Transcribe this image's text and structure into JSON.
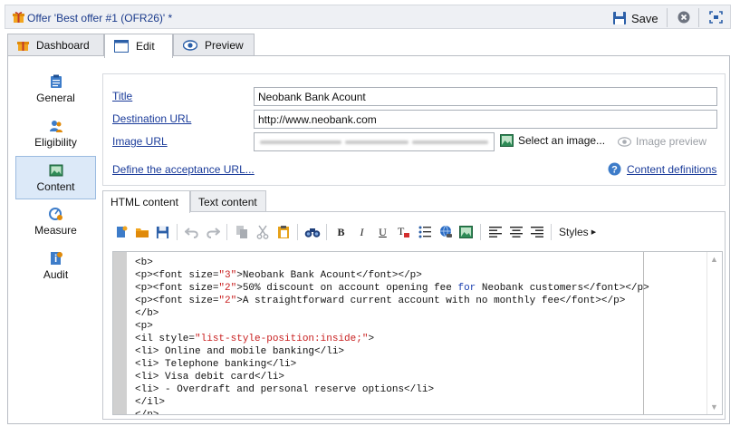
{
  "window": {
    "title": "Offer 'Best offer #1 (OFR26)' *",
    "save_label": "Save"
  },
  "tabs": [
    {
      "label": "Dashboard",
      "icon": "gift-icon"
    },
    {
      "label": "Edit",
      "icon": "edit-window-icon",
      "active": true
    },
    {
      "label": "Preview",
      "icon": "eye-icon"
    }
  ],
  "sidebar": {
    "items": [
      {
        "label": "General",
        "icon": "clipboard-icon"
      },
      {
        "label": "Eligibility",
        "icon": "users-icon"
      },
      {
        "label": "Content",
        "icon": "picture-icon",
        "selected": true
      },
      {
        "label": "Measure",
        "icon": "gauge-icon"
      },
      {
        "label": "Audit",
        "icon": "info-doc-icon"
      }
    ]
  },
  "form": {
    "title_label": "Title",
    "title_value": "Neobank Bank Acount",
    "dest_label": "Destination URL",
    "dest_value": "http://www.neobank.com",
    "image_label": "Image URL",
    "select_image": "Select an image...",
    "image_preview": "Image preview",
    "acceptance_link": "Define the acceptance URL...",
    "content_defs": "Content definitions"
  },
  "content_tabs": [
    {
      "label": "HTML content",
      "active": true
    },
    {
      "label": "Text content"
    }
  ],
  "toolbar": {
    "bold": "B",
    "italic": "I",
    "underline": "U",
    "styles": "Styles"
  },
  "code_lines": [
    "<b>",
    "<p><font size=\"3\">Neobank Bank Acount</font></p>",
    "<p><font size=\"2\">50% discount on account opening fee for Neobank customers</font></p>",
    "<p><font size=\"2\">A straightforward current account with no monthly fee</font></p>",
    "</b>",
    "<p>",
    "<il style=\"list-style-position:inside;\">",
    "<li> Online and mobile banking</li>",
    "<li> Telephone banking</li>",
    "<li> Visa debit card</li>",
    "<li> - Overdraft and personal reserve options</li>",
    "</il>",
    "</p>"
  ],
  "colors": {
    "accent": "#1a3b9a",
    "selected_bg": "#dce9f8",
    "attr_value": "#c81e1e"
  }
}
